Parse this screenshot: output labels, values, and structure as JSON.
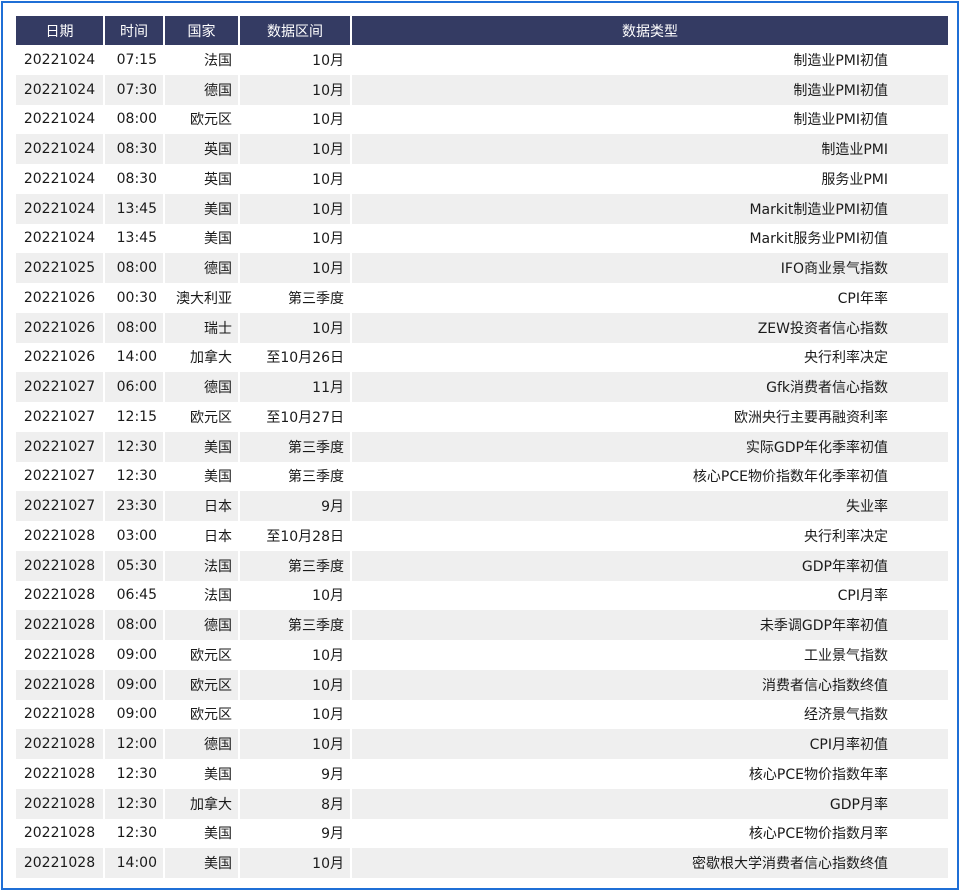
{
  "table": {
    "headers": [
      "日期",
      "时间",
      "国家",
      "数据区间",
      "数据类型"
    ],
    "rows": [
      [
        "20221024",
        "07:15",
        "法国",
        "10月",
        "制造业PMI初值"
      ],
      [
        "20221024",
        "07:30",
        "德国",
        "10月",
        "制造业PMI初值"
      ],
      [
        "20221024",
        "08:00",
        "欧元区",
        "10月",
        "制造业PMI初值"
      ],
      [
        "20221024",
        "08:30",
        "英国",
        "10月",
        "制造业PMI"
      ],
      [
        "20221024",
        "08:30",
        "英国",
        "10月",
        "服务业PMI"
      ],
      [
        "20221024",
        "13:45",
        "美国",
        "10月",
        "Markit制造业PMI初值"
      ],
      [
        "20221024",
        "13:45",
        "美国",
        "10月",
        "Markit服务业PMI初值"
      ],
      [
        "20221025",
        "08:00",
        "德国",
        "10月",
        "IFO商业景气指数"
      ],
      [
        "20221026",
        "00:30",
        "澳大利亚",
        "第三季度",
        "CPI年率"
      ],
      [
        "20221026",
        "08:00",
        "瑞士",
        "10月",
        "ZEW投资者信心指数"
      ],
      [
        "20221026",
        "14:00",
        "加拿大",
        "至10月26日",
        "央行利率决定"
      ],
      [
        "20221027",
        "06:00",
        "德国",
        "11月",
        "Gfk消费者信心指数"
      ],
      [
        "20221027",
        "12:15",
        "欧元区",
        "至10月27日",
        "欧洲央行主要再融资利率"
      ],
      [
        "20221027",
        "12:30",
        "美国",
        "第三季度",
        "实际GDP年化季率初值"
      ],
      [
        "20221027",
        "12:30",
        "美国",
        "第三季度",
        "核心PCE物价指数年化季率初值"
      ],
      [
        "20221027",
        "23:30",
        "日本",
        "9月",
        "失业率"
      ],
      [
        "20221028",
        "03:00",
        "日本",
        "至10月28日",
        "央行利率决定"
      ],
      [
        "20221028",
        "05:30",
        "法国",
        "第三季度",
        "GDP年率初值"
      ],
      [
        "20221028",
        "06:45",
        "法国",
        "10月",
        "CPI月率"
      ],
      [
        "20221028",
        "08:00",
        "德国",
        "第三季度",
        "未季调GDP年率初值"
      ],
      [
        "20221028",
        "09:00",
        "欧元区",
        "10月",
        "工业景气指数"
      ],
      [
        "20221028",
        "09:00",
        "欧元区",
        "10月",
        "消费者信心指数终值"
      ],
      [
        "20221028",
        "09:00",
        "欧元区",
        "10月",
        "经济景气指数"
      ],
      [
        "20221028",
        "12:00",
        "德国",
        "10月",
        "CPI月率初值"
      ],
      [
        "20221028",
        "12:30",
        "美国",
        "9月",
        "核心PCE物价指数年率"
      ],
      [
        "20221028",
        "12:30",
        "加拿大",
        "8月",
        "GDP月率"
      ],
      [
        "20221028",
        "12:30",
        "美国",
        "9月",
        "核心PCE物价指数月率"
      ],
      [
        "20221028",
        "14:00",
        "美国",
        "10月",
        "密歇根大学消费者信心指数终值"
      ]
    ]
  },
  "colors": {
    "header_bg": "#343b63",
    "border": "#1f6fd6",
    "stripe": "#efefef"
  }
}
